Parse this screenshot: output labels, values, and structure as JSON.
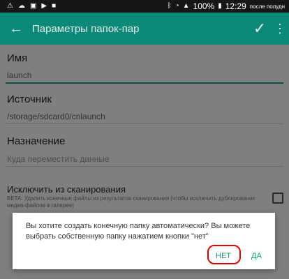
{
  "status": {
    "battery": "100%",
    "time": "12:29",
    "period": "после полудн",
    "icons": [
      "warning-icon",
      "cloud-icon",
      "image-icon",
      "play-icon",
      "briefcase-icon",
      "bluetooth-icon",
      "wifi-icon",
      "signal-icon",
      "battery-icon"
    ]
  },
  "appbar": {
    "title": "Параметры папок-пар"
  },
  "form": {
    "name_label": "Имя",
    "name_value": "launch",
    "source_label": "Источник",
    "source_value": "/storage/sdcard0/cnlaunch",
    "dest_label": "Назначение",
    "dest_placeholder": "Куда переместить данные",
    "exclude_label": "Исключить из сканирования",
    "exclude_sub": "BETA: Удалить конечные файлы из результатов сканирования (чтобы исключить дублирование медиа-файлов в галерее)"
  },
  "dialog": {
    "message": "Вы хотите создать конечную папку автоматически? Вы можете выбрать собственную папку нажатием кнопки \"нет\"",
    "no_label": "НЕТ",
    "yes_label": "ДА"
  },
  "colors": {
    "accent": "#0c8a79",
    "highlight_ring": "#e00000"
  }
}
